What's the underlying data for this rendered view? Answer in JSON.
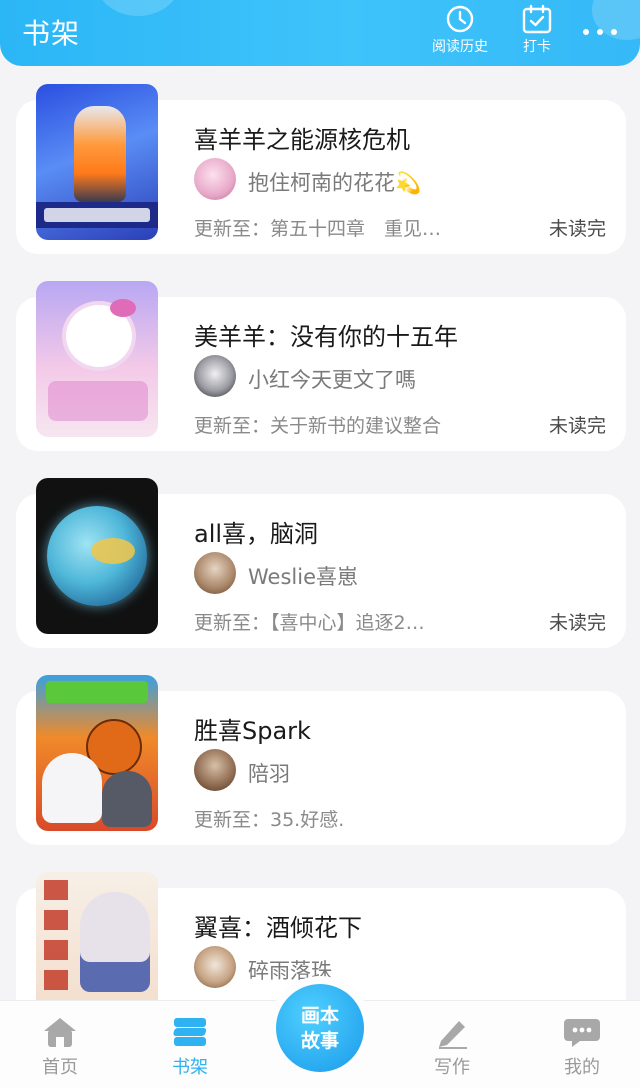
{
  "header": {
    "title": "书架",
    "history_label": "阅读历史",
    "checkin_label": "打卡"
  },
  "books": [
    {
      "title": "喜羊羊之能源核危机",
      "author": "抱住柯南的花花💫",
      "update": "更新至：第五十四章　重见…",
      "status": "未读完"
    },
    {
      "title": "美羊羊：没有你的十五年",
      "author": "小红今天更文了嗎",
      "update": "更新至：关于新书的建议整合",
      "status": "未读完"
    },
    {
      "title": "all喜，脑洞",
      "author": "Weslie喜崽",
      "update": "更新至：【喜中心】追逐2…",
      "status": "未读完"
    },
    {
      "title": "胜喜Spark",
      "author": "陪羽",
      "update": "更新至：35.好感.",
      "status": ""
    },
    {
      "title": "翼喜：酒倾花下",
      "author": "碎雨落珠",
      "update": "",
      "status": ""
    }
  ],
  "bottom_nav": {
    "home": "首页",
    "shelf": "书架",
    "center_line1": "画本",
    "center_line2": "故事",
    "write": "写作",
    "mine": "我的"
  },
  "colors": {
    "accent": "#2fb2f2",
    "header_gradient_start": "#2bb6f6",
    "header_gradient_end": "#3fc3fb"
  }
}
